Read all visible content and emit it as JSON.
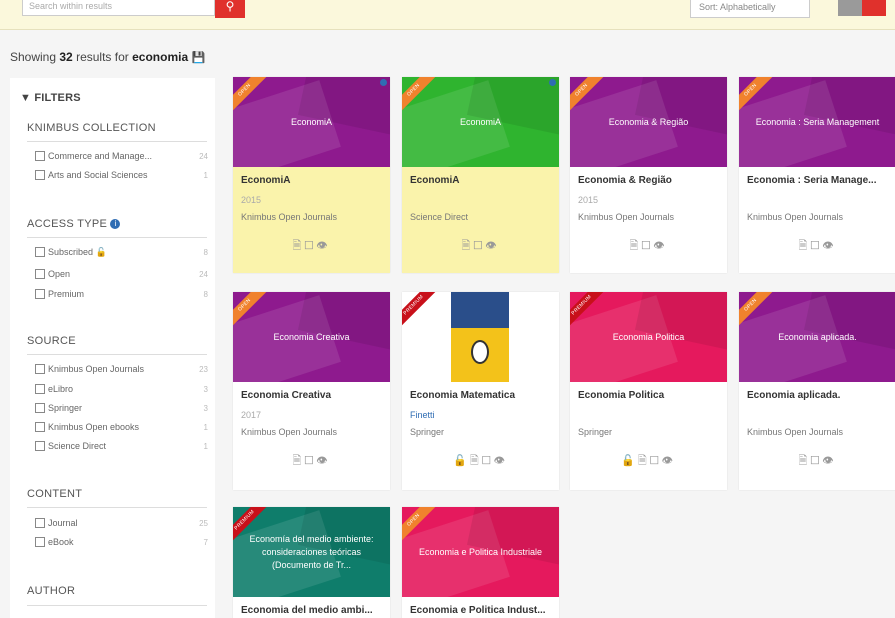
{
  "topbar": {
    "search_placeholder": "Search within results",
    "search_icon": "search-icon",
    "sort_label": "Sort: Alphabetically",
    "colors": {
      "bar": "#fbf8dc",
      "accent": "#e0312c"
    }
  },
  "results": {
    "prefix": "Showing",
    "count": "32",
    "middle": "results for",
    "query": "economia",
    "icon": "save-icon"
  },
  "filters": {
    "title": "FILTERS",
    "sections": [
      {
        "title": "KNIMBUS COLLECTION",
        "options": [
          {
            "label": "Commerce and Manage...",
            "count": "24"
          },
          {
            "label": "Arts and Social Sciences",
            "count": "1"
          }
        ]
      },
      {
        "title": "ACCESS TYPE",
        "options": [
          {
            "label": "Subscribed",
            "count": "8"
          },
          {
            "label": "Open",
            "count": "24"
          },
          {
            "label": "Premium",
            "count": "8"
          }
        ]
      },
      {
        "title": "SOURCE",
        "options": [
          {
            "label": "Knimbus Open Journals",
            "count": "23"
          },
          {
            "label": "eLibro",
            "count": "3"
          },
          {
            "label": "Springer",
            "count": "3"
          },
          {
            "label": "Knimbus Open ebooks",
            "count": "1"
          },
          {
            "label": "Science Direct",
            "count": "1"
          }
        ]
      },
      {
        "title": "CONTENT",
        "options": [
          {
            "label": "Journal",
            "count": "25"
          },
          {
            "label": "eBook",
            "count": "7"
          }
        ]
      },
      {
        "title": "AUTHOR",
        "options": []
      }
    ]
  },
  "cards": [
    {
      "cover_text": "EconomiA",
      "title": "EconomiA",
      "year": "2015",
      "source": "Knimbus Open Journals",
      "ribbon": "OPEN",
      "cover_color": "#8e1a8e"
    },
    {
      "cover_text": "EconomiA",
      "title": "EconomiA",
      "year": "",
      "source": "Science Direct",
      "ribbon": "OPEN",
      "cover_color": "#2fb42f"
    },
    {
      "cover_text": "Economia & Região",
      "title": "Economia & Região",
      "year": "2015",
      "source": "Knimbus Open Journals",
      "ribbon": "OPEN",
      "cover_color": "#8e1a8e"
    },
    {
      "cover_text": "Economia : Seria Management",
      "title": "Economia : Seria Manage...",
      "year": "",
      "source": "Knimbus Open Journals",
      "ribbon": "OPEN",
      "cover_color": "#8e1a8e"
    },
    {
      "cover_text": "Economia Creativa",
      "title": "Economia Creativa",
      "year": "2017",
      "source": "Knimbus Open Journals",
      "ribbon": "OPEN",
      "cover_color": "#8e1a8e"
    },
    {
      "cover_text": "",
      "title": "Economia Matematica",
      "author": "Finetti",
      "source": "Springer",
      "ribbon": "PREMIUM",
      "cover_color": "#ffffff"
    },
    {
      "cover_text": "Economia Politica",
      "title": "Economia Politica",
      "year": "",
      "source": "Springer",
      "ribbon": "PREMIUM",
      "cover_color": "#e5195d"
    },
    {
      "cover_text": "Economia aplicada.",
      "title": "Economia aplicada.",
      "year": "",
      "source": "Knimbus Open Journals",
      "ribbon": "OPEN",
      "cover_color": "#8e1a8e"
    },
    {
      "cover_text": "Economía del medio ambiente: consideraciones teóricas (Documento de Tr...",
      "title": "Economia del medio ambi...",
      "ribbon": "PREMIUM",
      "cover_color": "#0f7d6b"
    },
    {
      "cover_text": "Economia e Politica Industriale",
      "title": "Economia e Politica Indust...",
      "ribbon": "OPEN",
      "cover_color": "#e5195d"
    }
  ],
  "icons": {
    "read": "document-icon",
    "bookmark": "bookmark-icon",
    "view": "eye-icon",
    "unlock": "unlock-icon"
  }
}
